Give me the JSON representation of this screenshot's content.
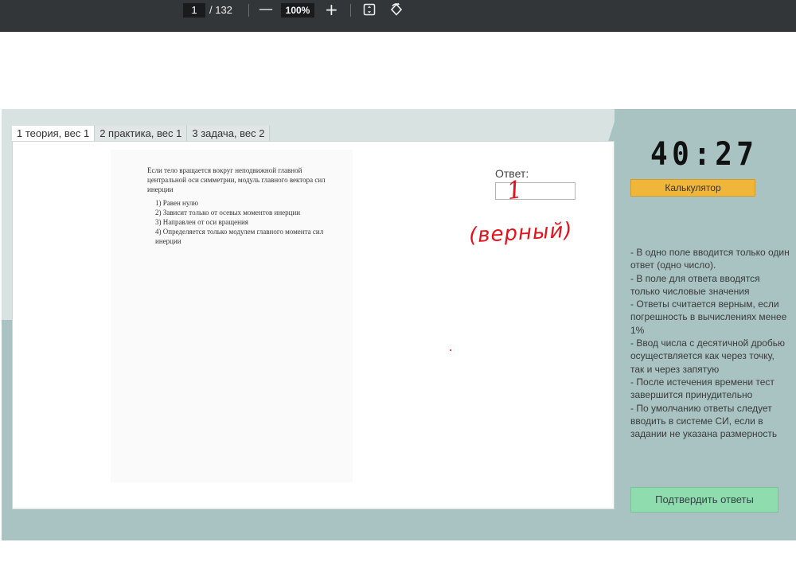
{
  "pdf_toolbar": {
    "current_page": "1",
    "total_pages": "/ 132",
    "zoom_out": "—",
    "zoom_level": "100%",
    "zoom_in": "+",
    "fit_icon": "fit-to-page-icon",
    "rotate_icon": "rotate-icon"
  },
  "tabs": [
    {
      "label": "1 теория, вес  1"
    },
    {
      "label": "2 практика, вес  1"
    },
    {
      "label": "3 задача, вес  2"
    }
  ],
  "question": {
    "text": "Если тело вращается вокруг неподвижной главной центральной оси симметрии, модуль главного вектора сил инерции",
    "options": [
      "1) Равен нулю",
      "2) Зависит только от осевых моментов инерции",
      "3) Направлен от оси вращения",
      "4)  Определяется только модулем главного момента сил инерции"
    ]
  },
  "answer": {
    "label": "Ответ:",
    "handwritten_value": "1",
    "handwritten_note": "(верный)"
  },
  "timer": "40:27",
  "calculator_label": "Калькулятор",
  "rules": [
    " - В одно поле вводится только один ответ (одно число).",
    " - В поле для ответа вводятся только числовые значения",
    " - Ответы считается верным, если погрешность в вычислениях менее 1%",
    " - Ввод числа с десятичной дробью осуществляется как через точку, так и через запятую",
    " - После истечения времени тест завершится принудительно",
    " - По умолчанию ответы следует вводить в системе СИ, если в задании не указана размерность"
  ],
  "submit_label": "Подтвердить ответы",
  "colors": {
    "toolbar": "#323639",
    "panel_bg": "#d8e3e1",
    "panel_accent": "#a9c3c3",
    "calculator": "#f0b63a",
    "submit": "#8fdcae",
    "handwriting": "#e3131d"
  }
}
